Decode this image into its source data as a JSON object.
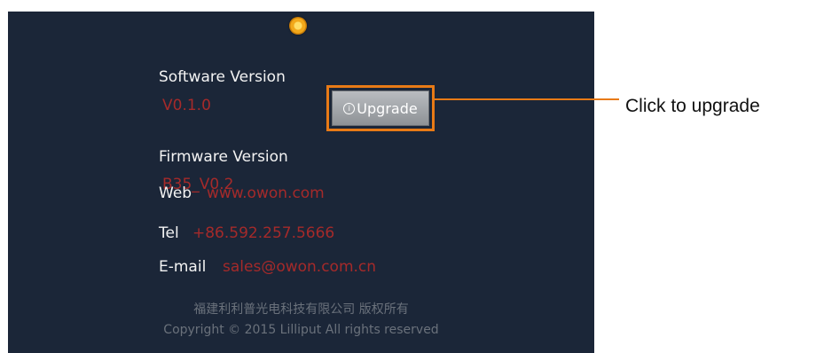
{
  "about": {
    "software_label": "Software Version",
    "software_value": "V0.1.0",
    "firmware_label": "Firmware Version",
    "firmware_value": "B35_V0.2",
    "web_label": "Web",
    "web_value": "www.owon.com",
    "tel_label": "Tel",
    "tel_value": "+86.592.257.5666",
    "email_label": "E-mail",
    "email_value": "sales@owon.com.cn",
    "footer_cn": "福建利利普光电科技有限公司 版权所有",
    "footer_copyright": "Copyright © 2015 Lilliput All rights reserved"
  },
  "upgrade_button": {
    "label": "Upgrade",
    "icon": "info-icon"
  },
  "annotation": {
    "text": "Click to upgrade"
  },
  "colors": {
    "background": "#1b2638",
    "value_text": "#a52a2a",
    "highlight": "#e87a16"
  }
}
